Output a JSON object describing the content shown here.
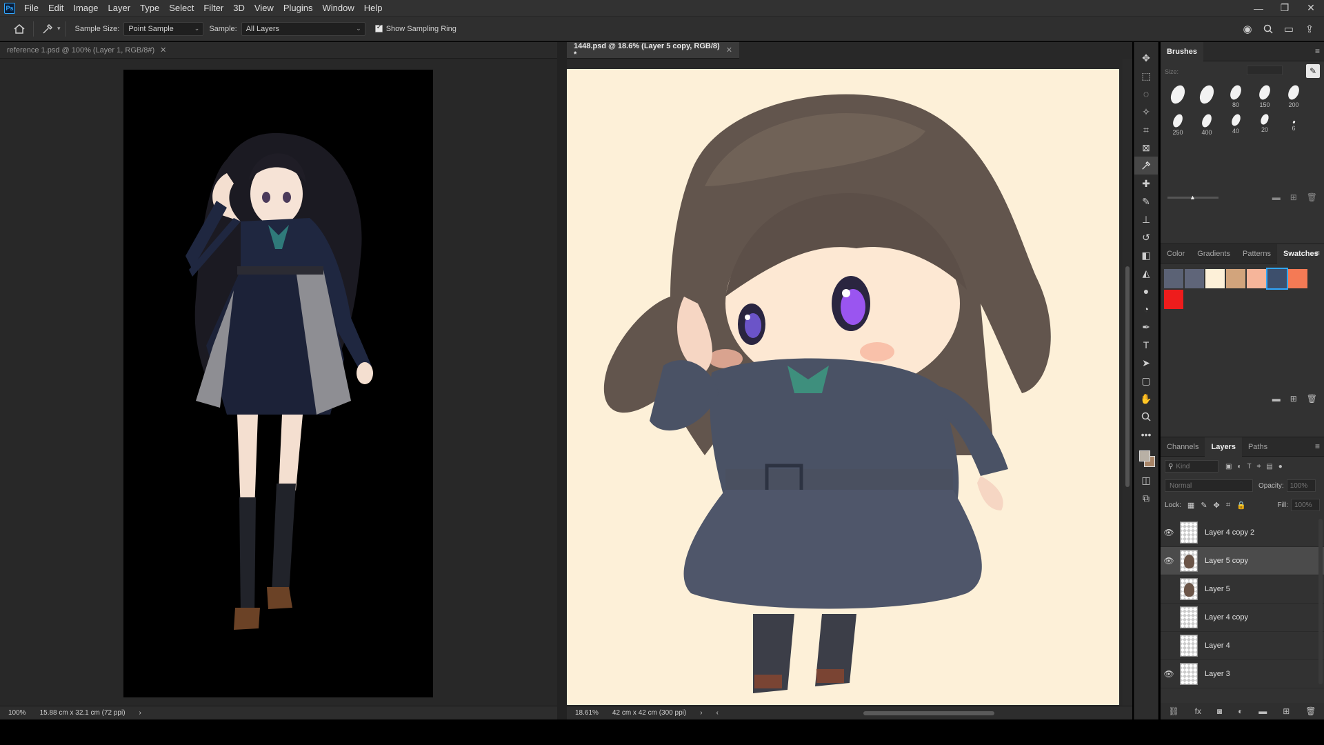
{
  "menu": [
    "File",
    "Edit",
    "Image",
    "Layer",
    "Type",
    "Select",
    "Filter",
    "3D",
    "View",
    "Plugins",
    "Window",
    "Help"
  ],
  "app_logo": "Ps",
  "window_controls": {
    "minimize": "—",
    "restore": "❐",
    "close": "✕"
  },
  "options": {
    "sample_size_label": "Sample Size:",
    "sample_size_value": "Point Sample",
    "sample_label": "Sample:",
    "sample_value": "All Layers",
    "show_ring_label": "Show Sampling Ring",
    "show_ring_checked": true
  },
  "doc1": {
    "tab_title": "reference 1.psd @ 100% (Layer 1, RGB/8#)",
    "zoom": "100%",
    "dimensions": "15.88 cm x 32.1 cm (72 ppi)"
  },
  "doc2": {
    "tab_title": "1448.psd @ 18.6% (Layer 5 copy, RGB/8) *",
    "zoom": "18.61%",
    "dimensions": "42 cm x 42 cm (300 ppi)"
  },
  "brushes": {
    "title": "Brushes",
    "size_label": "Size:",
    "presets": [
      {
        "label": ""
      },
      {
        "label": ""
      },
      {
        "label": "80"
      },
      {
        "label": "150"
      },
      {
        "label": "200"
      },
      {
        "label": "250"
      },
      {
        "label": "400"
      },
      {
        "label": "40"
      },
      {
        "label": "20"
      },
      {
        "label": "6"
      }
    ]
  },
  "swatch_tabs": [
    "Color",
    "Gradients",
    "Patterns",
    "Swatches"
  ],
  "swatches": [
    "#5b6275",
    "#5f6579",
    "#fdf0d8",
    "#d2a47c",
    "#f6b59a",
    "#3d4f6c",
    "#f47a55",
    "#ee1c1c"
  ],
  "layer_tabs": [
    "Channels",
    "Layers",
    "Paths"
  ],
  "layers_controls": {
    "kind_placeholder": "Kind",
    "blend_mode": "Normal",
    "opacity_label": "Opacity:",
    "opacity_value": "100%",
    "lock_label": "Lock:",
    "fill_label": "Fill:",
    "fill_value": "100%"
  },
  "layers": [
    {
      "name": "Layer 4 copy 2",
      "visible": true,
      "has_art": false,
      "selected": false
    },
    {
      "name": "Layer 5 copy",
      "visible": true,
      "has_art": true,
      "selected": true
    },
    {
      "name": "Layer 5",
      "visible": false,
      "has_art": true,
      "selected": false
    },
    {
      "name": "Layer 4 copy",
      "visible": false,
      "has_art": false,
      "selected": false
    },
    {
      "name": "Layer 4",
      "visible": false,
      "has_art": false,
      "selected": false
    },
    {
      "name": "Layer 3",
      "visible": true,
      "has_art": false,
      "selected": false
    }
  ]
}
